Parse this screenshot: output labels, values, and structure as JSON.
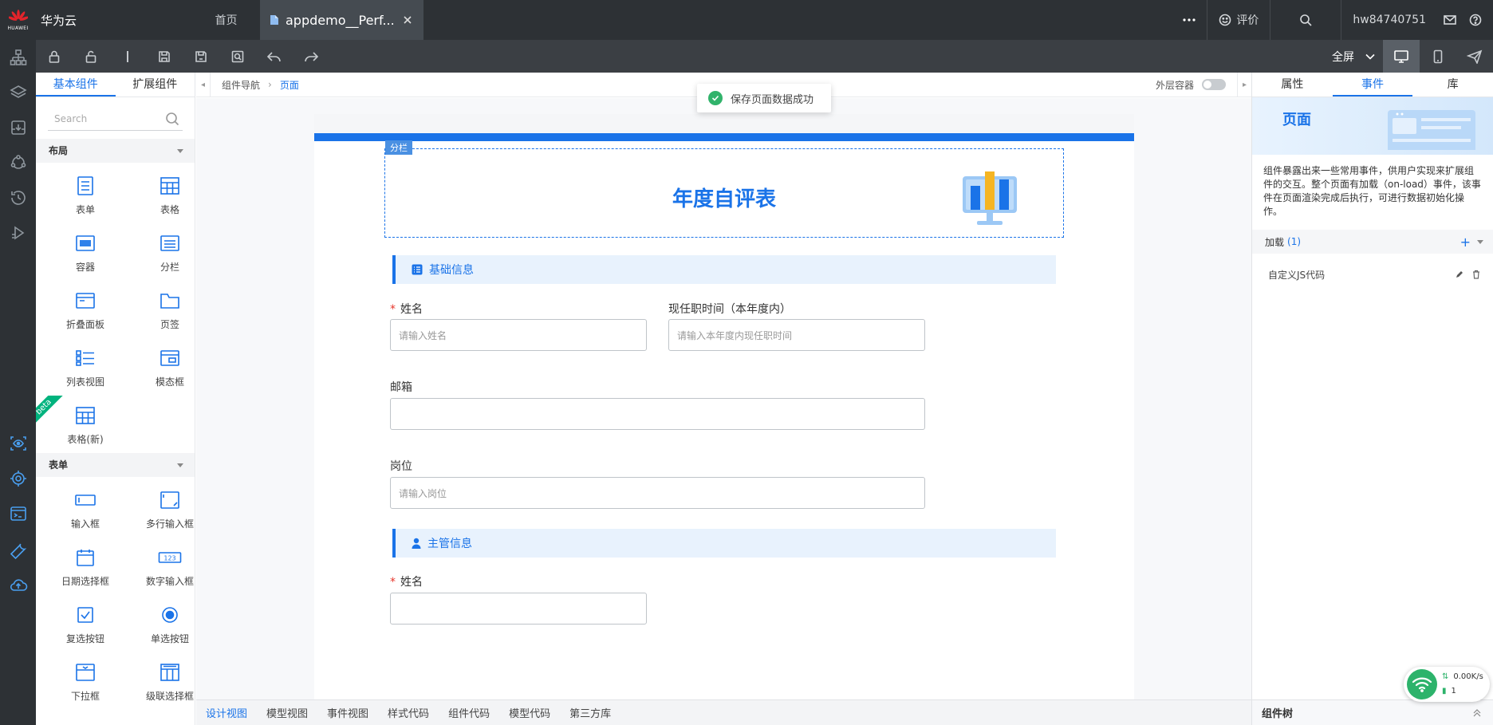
{
  "top": {
    "brand": "HUAWEI",
    "cloud_name": "华为云",
    "home_tab": "首页",
    "active_tab": "appdemo__Perf...",
    "rate": "评价",
    "username": "hw84740751"
  },
  "toolbar": {
    "fullscreen": "全屏"
  },
  "left_panel": {
    "tabs": [
      "基本组件",
      "扩展组件"
    ],
    "search_placeholder": "Search",
    "layout_section": "布局",
    "layout_items": [
      "表单",
      "表格",
      "容器",
      "分栏",
      "折叠面板",
      "页签",
      "列表视图",
      "模态框",
      "表格(新)"
    ],
    "beta": "beta",
    "form_section": "表单",
    "form_items": [
      "输入框",
      "多行输入框",
      "日期选择框",
      "数字输入框",
      "复选按钮",
      "单选按钮",
      "下拉框",
      "级联选择框"
    ]
  },
  "breadcrumb": {
    "root": "组件导航",
    "current": "页面"
  },
  "outer_container": "外层容器",
  "toast": "保存页面数据成功",
  "form": {
    "column_tag": "分栏",
    "title": "年度自评表",
    "section1": "基础信息",
    "name_label": "姓名",
    "name_placeholder": "请输入姓名",
    "tenure_label": "现任职时间（本年度内）",
    "tenure_placeholder": "请输入本年度内现任职时间",
    "email_label": "邮箱",
    "position_label": "岗位",
    "position_placeholder": "请输入岗位",
    "section2": "主管信息",
    "manager_name_label": "姓名"
  },
  "bottom_tabs": [
    "设计视图",
    "模型视图",
    "事件视图",
    "样式代码",
    "组件代码",
    "模型代码",
    "第三方库"
  ],
  "right_panel": {
    "tabs": [
      "属性",
      "事件",
      "库"
    ],
    "banner_title": "页面",
    "description": "组件暴露出来一些常用事件，供用户实现来扩展组件的交互。整个页面有加载（on-load）事件，该事件在页面渲染完成后执行，可进行数据初始化操作。",
    "load_label": "加载",
    "load_count": "(1)",
    "custom_js": "自定义JS代码",
    "component_tree": "组件树"
  },
  "network": {
    "speed": "0.00K/s",
    "count": "1"
  },
  "colors": {
    "accent": "#1a73e8",
    "topbar": "#2d3135",
    "required": "#e6362b",
    "success": "#31b36b"
  }
}
